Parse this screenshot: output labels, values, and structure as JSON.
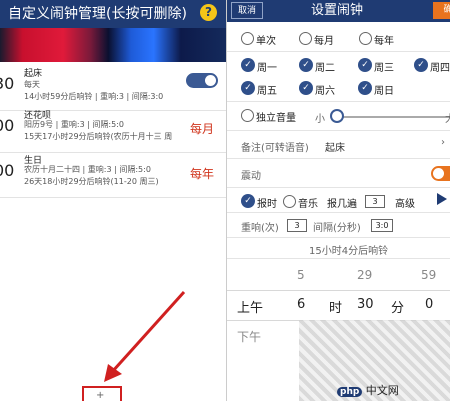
{
  "left": {
    "title": "自定义闹钟管理(长按可删除)",
    "help_label": "?",
    "alarms": [
      {
        "time": "30",
        "title": "起床",
        "lines": [
          "每天",
          "14小时59分后响铃 | 重响:3 | 间隔:3:0"
        ],
        "tag": ""
      },
      {
        "time": "00",
        "title": "还花呗",
        "lines": [
          "阳历9号 | 重响:3 | 间隔:5:0",
          "15天17小时29分后响铃(农历十月十三 周"
        ],
        "tag": "每月"
      },
      {
        "time": "00",
        "title": "生日",
        "lines": [
          "农历十月二十四 | 重响:3 | 间隔:5:0",
          "26天18小时29分后响铃(11-20 周三)"
        ],
        "tag": "每年"
      }
    ],
    "bottom_icon": "+"
  },
  "right": {
    "cancel": "取消",
    "title": "设置闹钟",
    "ok": "确",
    "repeat_modes": [
      "单次",
      "每月",
      "每年"
    ],
    "weekdays": [
      "周一",
      "周二",
      "周三",
      "周四",
      "周五",
      "周六",
      "周日"
    ],
    "volume": {
      "label": "独立音量",
      "small": "小",
      "large": "大"
    },
    "note_label": "备注(可转语音)",
    "note_value": "起床",
    "vibrate_label": "震动",
    "alert": {
      "report": "报时",
      "music": "音乐",
      "report_times_label": "报几遍",
      "report_times": "3",
      "advanced": "高级"
    },
    "repeat": {
      "label": "重响(次)",
      "count": "3",
      "interval_label": "间隔(分秒)",
      "interval": "3:0"
    },
    "countdown": "15小时4分后响铃",
    "picker": {
      "above": [
        "5",
        "29",
        "59"
      ],
      "ampm": "上午",
      "hour": "6",
      "hour_unit": "时",
      "minute": "30",
      "minute_unit": "分",
      "second": "0",
      "below_ampm": "下午"
    },
    "watermark": "中文网"
  },
  "colors": {
    "nav": "#1f3b73",
    "accent": "#e8731e",
    "tag": "#d0341c",
    "annotation": "#d02020"
  }
}
